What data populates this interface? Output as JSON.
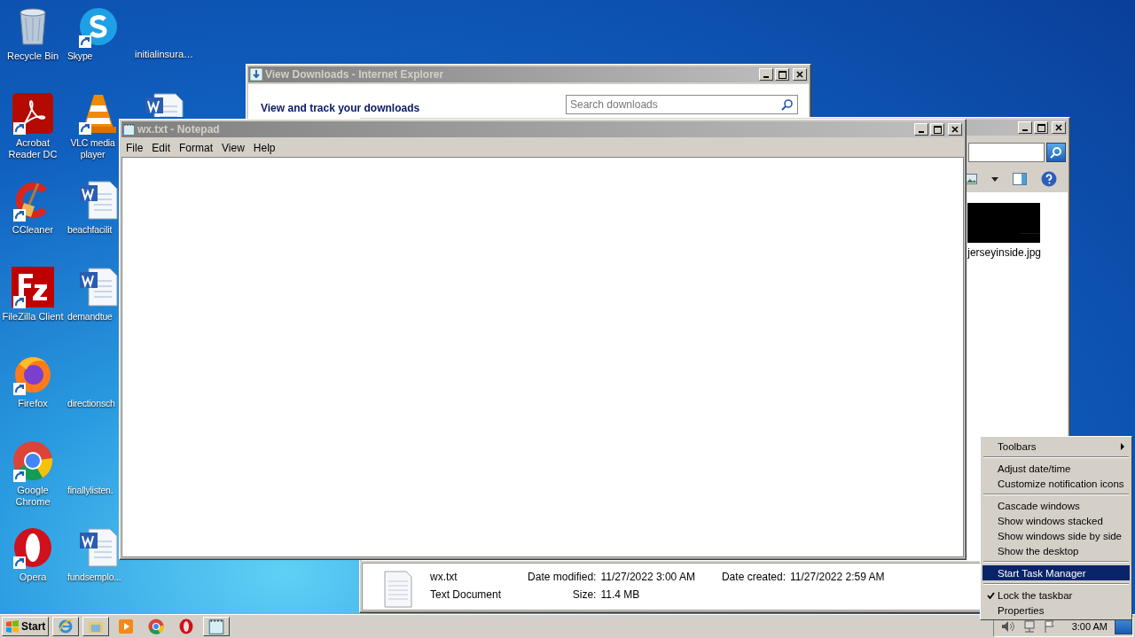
{
  "desktop_icons": [
    {
      "label": "Recycle Bin",
      "kind": "recycle",
      "shortcut": false
    },
    {
      "label": "Acrobat Reader DC",
      "kind": "acrobat",
      "shortcut": true
    },
    {
      "label": "CCleaner",
      "kind": "ccleaner",
      "shortcut": true
    },
    {
      "label": "FileZilla Client",
      "kind": "filezilla",
      "shortcut": true
    },
    {
      "label": "Firefox",
      "kind": "firefox",
      "shortcut": true
    },
    {
      "label": "Google Chrome",
      "kind": "chrome",
      "shortcut": true
    },
    {
      "label": "Opera",
      "kind": "opera",
      "shortcut": true
    },
    {
      "label": "Skype",
      "kind": "skype",
      "shortcut": true
    },
    {
      "label": "VLC media player",
      "kind": "vlc",
      "shortcut": true
    },
    {
      "label": "beachfacilit",
      "kind": "word",
      "shortcut": false
    },
    {
      "label": "demandtue",
      "kind": "word",
      "shortcut": false
    },
    {
      "label": "directionsch",
      "kind": "blank",
      "shortcut": false
    },
    {
      "label": "finallylisten.",
      "kind": "blank",
      "shortcut": false
    },
    {
      "label": "fundsemplo...",
      "kind": "word",
      "shortcut": false
    },
    {
      "label": "initialinsura…",
      "kind": "blank",
      "shortcut": false
    },
    {
      "kind": "word",
      "shortcut": false
    }
  ],
  "downloads_window": {
    "title": "View Downloads - Internet Explorer",
    "heading": "View and track your downloads",
    "search": {
      "placeholder": "Search downloads"
    }
  },
  "explorer_window": {
    "thumbnail": {
      "kind": "picture",
      "label": "jerseyinside.jpg"
    },
    "details": {
      "file_name": "wx.txt",
      "file_type": "Text Document",
      "columns": [
        [
          {
            "label": "Date modified:",
            "value": "11/27/2022 3:00 AM"
          },
          {
            "label": "Size:",
            "value": "11.4 MB"
          }
        ],
        [
          {
            "label": "Date created:",
            "value": "11/27/2022 2:59 AM"
          }
        ]
      ]
    }
  },
  "notepad_window": {
    "title": "wx.txt - Notepad",
    "menu": [
      "File",
      "Edit",
      "Format",
      "View",
      "Help"
    ]
  },
  "context_menu": {
    "groups": [
      [
        {
          "label": "Toolbars",
          "kind": "submenu",
          "selected": false,
          "checked": false
        }
      ],
      [
        {
          "label": "Adjust date/time",
          "kind": "command",
          "selected": false,
          "checked": false
        },
        {
          "label": "Customize notification icons",
          "kind": "command",
          "selected": false,
          "checked": false
        }
      ],
      [
        {
          "label": "Cascade windows",
          "kind": "command",
          "selected": false,
          "checked": false
        },
        {
          "label": "Show windows stacked",
          "kind": "command",
          "selected": false,
          "checked": false
        },
        {
          "label": "Show windows side by side",
          "kind": "command",
          "selected": false,
          "checked": false
        },
        {
          "label": "Show the desktop",
          "kind": "command",
          "selected": false,
          "checked": false
        }
      ],
      [
        {
          "label": "Start Task Manager",
          "kind": "command",
          "selected": true,
          "checked": false
        }
      ],
      [
        {
          "label": "Lock the taskbar",
          "kind": "command",
          "selected": false,
          "checked": true
        },
        {
          "label": "Properties",
          "kind": "command",
          "selected": false,
          "checked": false
        }
      ]
    ]
  },
  "taskbar": {
    "start": "Start",
    "items": [
      {
        "kind": "ie",
        "running": true
      },
      {
        "kind": "explorer",
        "running": true
      },
      {
        "kind": "media",
        "running": false
      },
      {
        "kind": "chrome",
        "running": false
      },
      {
        "kind": "opera",
        "running": false
      },
      {
        "kind": "notepad",
        "running": true
      }
    ],
    "clock": "3:00 AM"
  }
}
